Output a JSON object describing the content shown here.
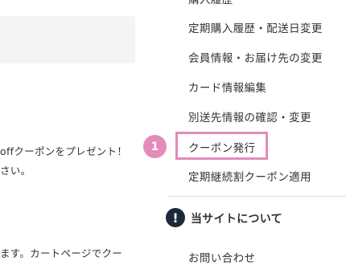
{
  "content": {
    "line1": "offクーポンをプレゼント！",
    "line2": "さい。",
    "line3": "ます。カートページでクー"
  },
  "menu": {
    "items": [
      {
        "label": "購入履歴"
      },
      {
        "label": "定期購入履歴・配送日変更"
      },
      {
        "label": "会員情報・お届け先の変更"
      },
      {
        "label": "カード情報編集"
      },
      {
        "label": "別送先情報の確認・変更"
      },
      {
        "label": "クーポン発行"
      },
      {
        "label": "定期継続割クーポン適用"
      }
    ],
    "section_heading": "当サイトについて",
    "next_item": "お問い合わせ"
  },
  "annotation": {
    "step_number": "1",
    "color": "#e48bb9"
  },
  "icons": {
    "info": "info-icon"
  }
}
